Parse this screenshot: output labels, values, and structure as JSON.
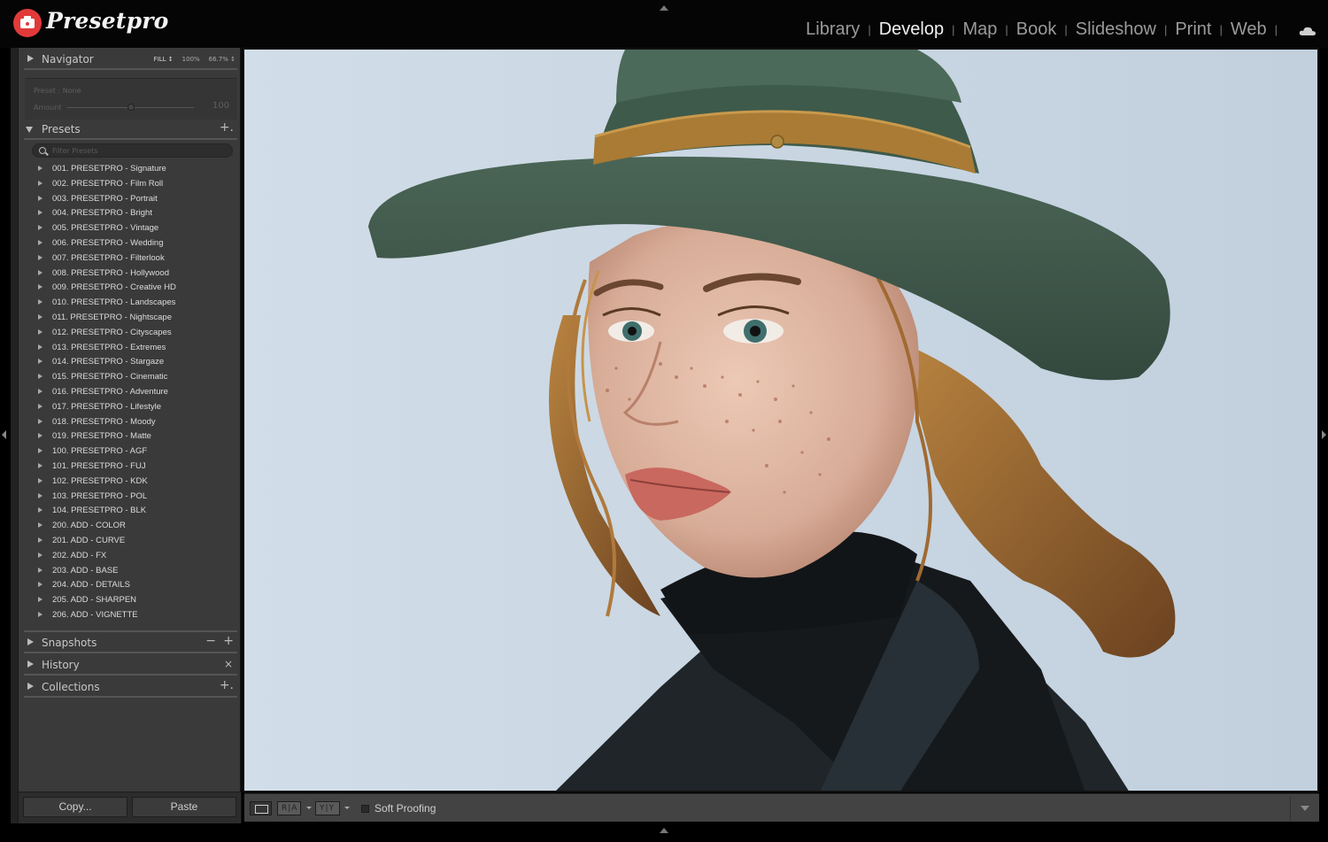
{
  "app": {
    "logo_text": "Presetpro"
  },
  "modules": [
    {
      "label": "Library",
      "active": false
    },
    {
      "label": "Develop",
      "active": true
    },
    {
      "label": "Map",
      "active": false
    },
    {
      "label": "Book",
      "active": false
    },
    {
      "label": "Slideshow",
      "active": false
    },
    {
      "label": "Print",
      "active": false
    },
    {
      "label": "Web",
      "active": false
    }
  ],
  "module_separator": "|",
  "navigator": {
    "title": "Navigator",
    "zoom_options": [
      "FILL ↕",
      "100%",
      "66.7% ↕"
    ]
  },
  "preset_amount": {
    "preset_label": "Preset : None",
    "amount_label": "Amount",
    "amount_value": "100",
    "amount_fraction": 0.5
  },
  "presets": {
    "title": "Presets",
    "add_symbol": "+.",
    "filter_placeholder": "Filter Presets",
    "items": [
      "001. PRESETPRO - Signature",
      "002. PRESETPRO - Film Roll",
      "003. PRESETPRO - Portrait",
      "004. PRESETPRO - Bright",
      "005. PRESETPRO - Vintage",
      "006. PRESETPRO - Wedding",
      "007. PRESETPRO - Filterlook",
      "008. PRESETPRO - Hollywood",
      "009. PRESETPRO - Creative HD",
      "010. PRESETPRO - Landscapes",
      "011. PRESETPRO - Nightscape",
      "012. PRESETPRO - Cityscapes",
      "013. PRESETPRO - Extremes",
      "014. PRESETPRO - Stargaze",
      "015. PRESETPRO - Cinematic",
      "016. PRESETPRO - Adventure",
      "017. PRESETPRO - Lifestyle",
      "018. PRESETPRO - Moody",
      "019. PRESETPRO - Matte",
      "100. PRESETPRO - AGF",
      "101. PRESETPRO - FUJ",
      "102. PRESETPRO - KDK",
      "103. PRESETPRO - POL",
      "104. PRESETPRO - BLK",
      "200. ADD - COLOR",
      "201. ADD - CURVE",
      "202. ADD - FX",
      "203. ADD - BASE",
      "204. ADD - DETAILS",
      "205. ADD - SHARPEN",
      "206. ADD - VIGNETTE"
    ]
  },
  "snapshots": {
    "title": "Snapshots",
    "minus_symbol": "−",
    "plus_symbol": "+"
  },
  "history": {
    "title": "History",
    "clear_symbol": "×"
  },
  "collections": {
    "title": "Collections",
    "add_symbol": "+."
  },
  "footer": {
    "copy_label": "Copy...",
    "paste_label": "Paste"
  },
  "toolbar": {
    "ra_label": "R|A",
    "yy_label": "Y|Y",
    "soft_proofing_label": "Soft Proofing",
    "soft_proofing_checked": false
  },
  "colors": {
    "brand_red": "#e23a3a",
    "panel_bg": "#3a3a3a",
    "toolbar_bg": "#434343",
    "photo_background": "#cbd7e3",
    "hat": "#3f5a4c",
    "hat_band": "#a97b35",
    "coat": "#1e2428",
    "hair": "#8a5a2e",
    "skin": "#dcb3a0"
  },
  "photo": {
    "icon_name": "portrait-photo",
    "subject": "woman with green felt hat, freckles and dark coat"
  }
}
